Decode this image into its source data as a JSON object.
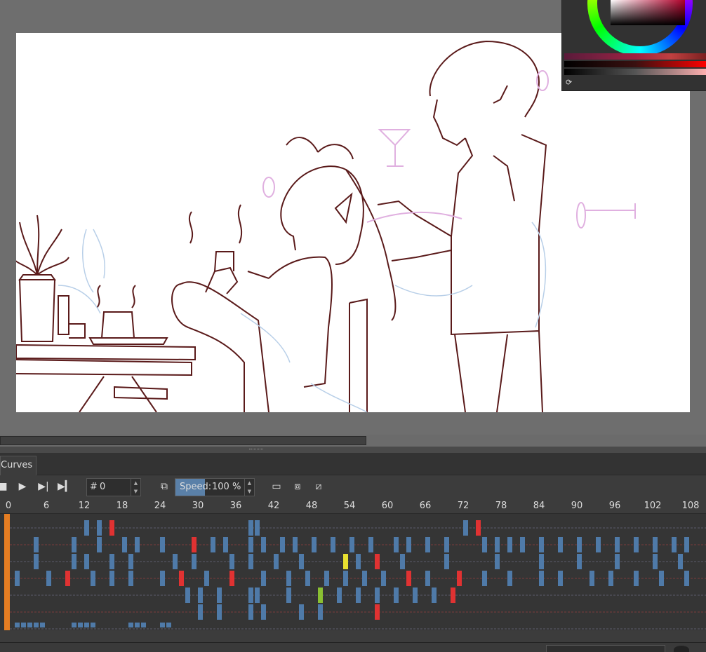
{
  "animation_docker": {
    "tab_label": "Curves",
    "frame_hash": "#",
    "frame_value": "0",
    "speed_label": "Speed:",
    "speed_value": "100 %",
    "ruler_ticks": [
      "0",
      "6",
      "12",
      "18",
      "24",
      "30",
      "36",
      "42",
      "48",
      "54",
      "60",
      "66",
      "72",
      "78",
      "84",
      "90",
      "96",
      "102",
      "108"
    ]
  },
  "colors": {
    "keyframe_blue": "#4f7aa8",
    "keyframe_red": "#e03232",
    "keyframe_green": "#8ac032",
    "keyframe_yellow": "#e8e030",
    "playhead": "#e57d22"
  },
  "icons": {
    "stop": "stop-icon",
    "play": "play-icon",
    "next_frame": "next-frame-icon",
    "last_frame": "last-frame-icon",
    "drop_frames": "drop-frames-icon",
    "onion_skin": "onion-skin-icon",
    "onion_skin_multi": "onion-skin-multi-icon",
    "no_onion": "no-onion-icon",
    "reset": "reset-icon"
  }
}
